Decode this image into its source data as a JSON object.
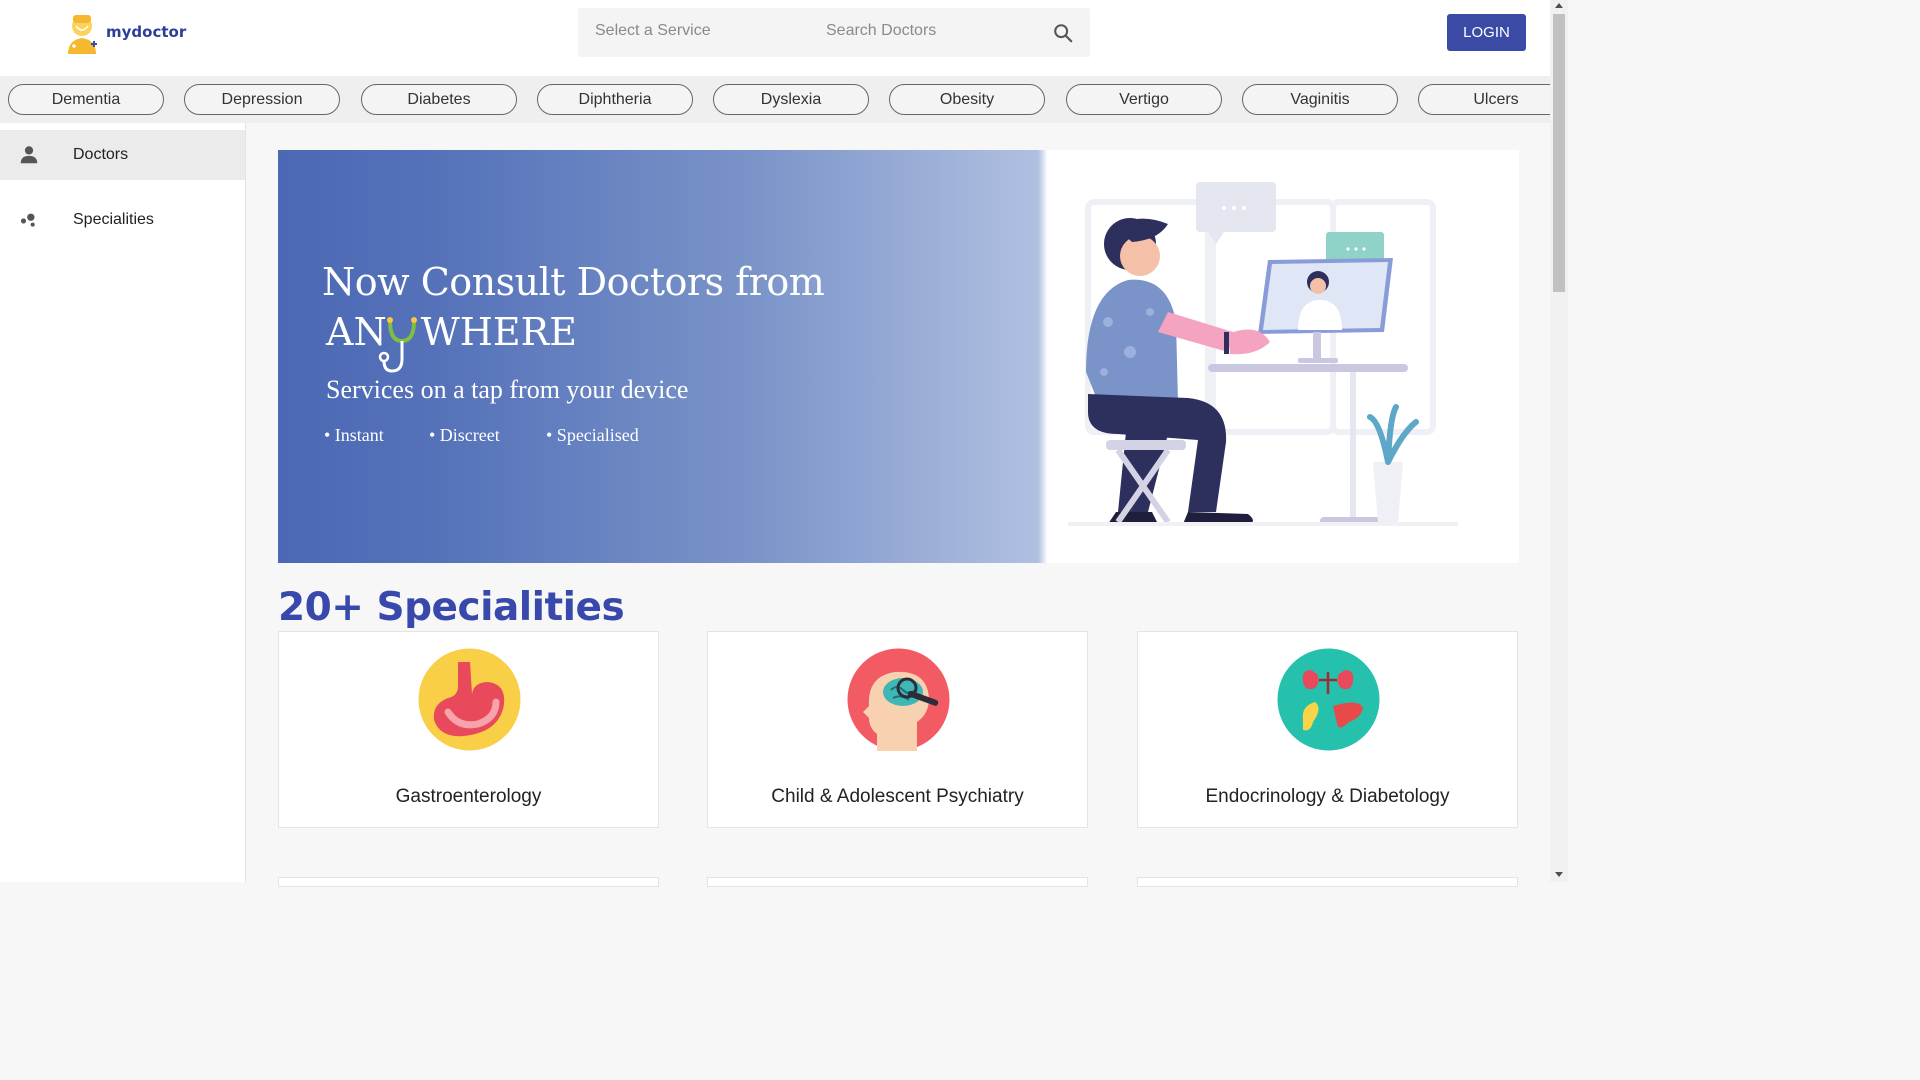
{
  "header": {
    "logo_text": "mydoctor",
    "search": {
      "service_placeholder": "Select a Service",
      "doctors_placeholder": "Search Doctors"
    },
    "login_label": "LOGIN"
  },
  "chips": [
    "Dementia",
    "Depression",
    "Diabetes",
    "Diphtheria",
    "Dyslexia",
    "Obesity",
    "Vertigo",
    "Vaginitis",
    "Ulcers"
  ],
  "sidebar": {
    "items": [
      {
        "label": "Doctors",
        "icon": "person-icon",
        "active": true
      },
      {
        "label": "Specialities",
        "icon": "bubbles-icon",
        "active": false
      }
    ]
  },
  "banner": {
    "title_line1": "Now Consult Doctors from",
    "title_line2_prefix": "AN",
    "title_line2_suffix": "WHERE",
    "subtitle": "Services on a tap from your device",
    "bullets": [
      "• Instant",
      "• Discreet",
      "• Specialised"
    ]
  },
  "specialities": {
    "heading": "20+ Specialities",
    "cards": [
      {
        "label": "Gastroenterology",
        "icon": "stomach-icon"
      },
      {
        "label": "Child & Adolescent Psychiatry",
        "icon": "brain-icon"
      },
      {
        "label": "Endocrinology & Diabetology",
        "icon": "organs-icon"
      }
    ]
  },
  "colors": {
    "brand": "#3b4aa4",
    "heading": "#3949ab",
    "banner_start": "#4c68b4"
  }
}
